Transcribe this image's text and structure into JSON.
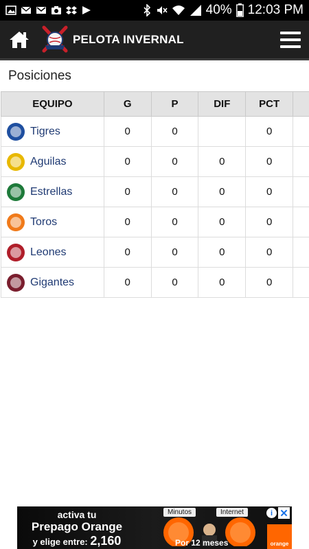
{
  "status_bar": {
    "battery": "40%",
    "time": "12:03 PM",
    "left_icons": [
      "photo-icon",
      "mail-icon",
      "gmail-icon",
      "camera-icon",
      "dropbox-icon",
      "play-store-icon"
    ],
    "right_icons": [
      "bluetooth-icon",
      "mute-icon",
      "wifi-icon",
      "signal-icon",
      "battery-icon"
    ]
  },
  "app_bar": {
    "title": "PELOTA INVERNAL",
    "home_icon": "home-icon",
    "menu_icon": "hamburger-menu-icon"
  },
  "section": {
    "title": "Posiciones"
  },
  "table": {
    "headers": [
      "EQUIPO",
      "G",
      "P",
      "DIF",
      "PCT"
    ],
    "rows": [
      {
        "team": "Tigres",
        "g": "0",
        "p": "0",
        "dif": "",
        "pct": "0",
        "logo_color": "#1f4fa0"
      },
      {
        "team": "Aguilas",
        "g": "0",
        "p": "0",
        "dif": "0",
        "pct": "0",
        "logo_color": "#e8b800"
      },
      {
        "team": "Estrellas",
        "g": "0",
        "p": "0",
        "dif": "0",
        "pct": "0",
        "logo_color": "#1e7a3a"
      },
      {
        "team": "Toros",
        "g": "0",
        "p": "0",
        "dif": "0",
        "pct": "0",
        "logo_color": "#f07a1a"
      },
      {
        "team": "Leones",
        "g": "0",
        "p": "0",
        "dif": "0",
        "pct": "0",
        "logo_color": "#b01e2a"
      },
      {
        "team": "Gigantes",
        "g": "0",
        "p": "0",
        "dif": "0",
        "pct": "0",
        "logo_color": "#7a1e2e"
      }
    ]
  },
  "ad": {
    "line1": "activa tu",
    "line2": "Prepago Orange",
    "line3_prefix": "y elige entre:",
    "line3_value": "2,160",
    "tag1": "Minutos",
    "tag2": "Internet",
    "footer": "Por 12 meses",
    "brand": "orange",
    "colors": {
      "brand": "#ff6600"
    }
  }
}
